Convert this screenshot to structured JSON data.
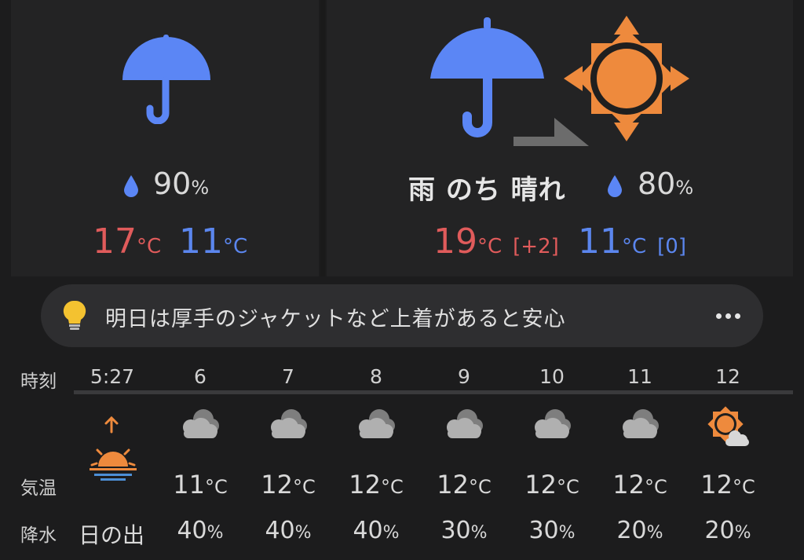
{
  "left": {
    "precip_value": "90",
    "precip_unit": "%",
    "high_value": "17",
    "low_value": "11",
    "temp_unit": "°C"
  },
  "right": {
    "condition": "雨 のち 晴れ",
    "precip_value": "80",
    "precip_unit": "%",
    "high_value": "19",
    "low_value": "11",
    "temp_unit": "°C",
    "high_delta": "[+2]",
    "low_delta": "[0]"
  },
  "advice": {
    "text": "明日は厚手のジャケットなど上着があると安心"
  },
  "table": {
    "label_time": "時刻",
    "label_temp": "気温",
    "label_precip": "降水",
    "sunrise_label": "日の出",
    "temp_unit": "°C",
    "precip_unit": "%",
    "hours": [
      "5:27",
      "6",
      "7",
      "8",
      "9",
      "10",
      "11",
      "12"
    ],
    "icons": [
      "sunrise-icon",
      "cloud-icon",
      "cloud-icon",
      "cloud-icon",
      "cloud-icon",
      "cloud-icon",
      "cloud-icon",
      "sun-cloud-icon"
    ],
    "temps": [
      "",
      "11",
      "12",
      "12",
      "12",
      "12",
      "12",
      "12"
    ],
    "precip": [
      "",
      "40",
      "40",
      "40",
      "30",
      "30",
      "20",
      "20"
    ]
  },
  "colors": {
    "rain_blue": "#5b86f5",
    "sun_orange": "#ee8a3d",
    "high_red": "#e05b5b",
    "low_blue": "#5b86ee",
    "cloud_gray": "#9a9a9a"
  }
}
